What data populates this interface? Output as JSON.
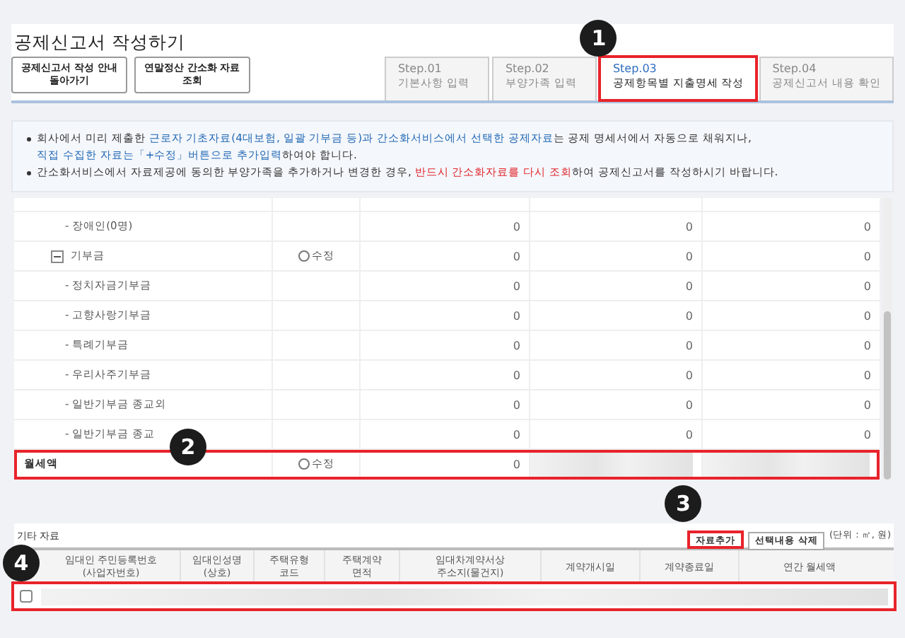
{
  "title": "공제신고서 작성하기",
  "nav_buttons": [
    {
      "label": "공제신고서 작성 안내\n돌아가기"
    },
    {
      "label": "연말정산 간소화 자료\n조회"
    }
  ],
  "steps": [
    {
      "step": "Step.01",
      "label": "기본사항 입력",
      "selected": false,
      "highlighted": false
    },
    {
      "step": "Step.02",
      "label": "부양가족 입력",
      "selected": false,
      "highlighted": false
    },
    {
      "step": "Step.03",
      "label": "공제항목별 지출명세 작성",
      "selected": true,
      "highlighted": true,
      "callout": "1"
    },
    {
      "step": "Step.04",
      "label": "공제신고서 내용 확인",
      "selected": false,
      "highlighted": false
    }
  ],
  "notices": [
    {
      "lines": [
        [
          {
            "text": "회사에서 미리 제출한 "
          },
          {
            "text": "근로자 기초자료(4대보험, 일괄 기부금 등)과 간소화서비스에서 선택한 공제자료",
            "color": "#2168b5"
          },
          {
            "text": "는 공제 명세서에서 자동으로 채워지나,"
          }
        ],
        [
          {
            "text": "직접 수집한 자료는「+수정」버튼으로 추가입력",
            "color": "#2168b5"
          },
          {
            "text": "하여야 합니다."
          }
        ]
      ]
    },
    {
      "lines": [
        [
          {
            "text": "간소화서비스에서 자료제공에 동의한 부양가족을 추가하거나 변경한 경우, "
          },
          {
            "text": "반드시 간소화자료를 다시 조회",
            "color": "#e0242a"
          },
          {
            "text": "하여 공제신고서를 작성하시기 바랍니다."
          }
        ]
      ]
    }
  ],
  "table": {
    "rows": [
      {
        "kind": "sub",
        "label": "- 장애인(0명)",
        "values": [
          "0",
          "0",
          "0"
        ],
        "highlighted": false
      },
      {
        "kind": "group",
        "label": "기부금",
        "expanded": true,
        "edit_label": "수정",
        "values": [
          "0",
          "0",
          "0"
        ],
        "highlighted": false
      },
      {
        "kind": "sub",
        "label": "- 정치자금기부금",
        "values": [
          "0",
          "0",
          "0"
        ],
        "highlighted": false
      },
      {
        "kind": "sub",
        "label": "- 고향사랑기부금",
        "values": [
          "0",
          "0",
          "0"
        ],
        "highlighted": false
      },
      {
        "kind": "sub",
        "label": "- 특례기부금",
        "values": [
          "0",
          "0",
          "0"
        ],
        "highlighted": false
      },
      {
        "kind": "sub",
        "label": "- 우리사주기부금",
        "values": [
          "0",
          "0",
          "0"
        ],
        "highlighted": false
      },
      {
        "kind": "sub",
        "label": "- 일반기부금 종교외",
        "values": [
          "0",
          "0",
          "0"
        ],
        "highlighted": false
      },
      {
        "kind": "sub",
        "label": "- 일반기부금 종교",
        "values": [
          "0",
          "0",
          "0"
        ],
        "highlighted": false
      },
      {
        "kind": "main",
        "label": "월세액",
        "edit_label": "수정",
        "values": [
          "0"
        ],
        "masked": true,
        "highlighted": true,
        "callout": "2"
      }
    ]
  },
  "other_data": {
    "title": "기타 자료",
    "buttons": [
      {
        "label": "자료추가",
        "highlighted": true,
        "callout": "3"
      },
      {
        "label": "선택내용 삭제",
        "highlighted": false
      }
    ],
    "unit": "(단위 : ㎡, 원)",
    "columns": [
      "임대인 주민등록번호\n(사업자번호)",
      "임대인성명\n(상호)",
      "주택유형\n코드",
      "주택계약\n면적",
      "임대차계약서상\n주소지(물건지)",
      "계약개시일",
      "계약종료일",
      "연간 월세액"
    ],
    "rows": [
      {
        "checked": false,
        "masked": true,
        "highlighted": true,
        "callout": "4"
      }
    ]
  }
}
